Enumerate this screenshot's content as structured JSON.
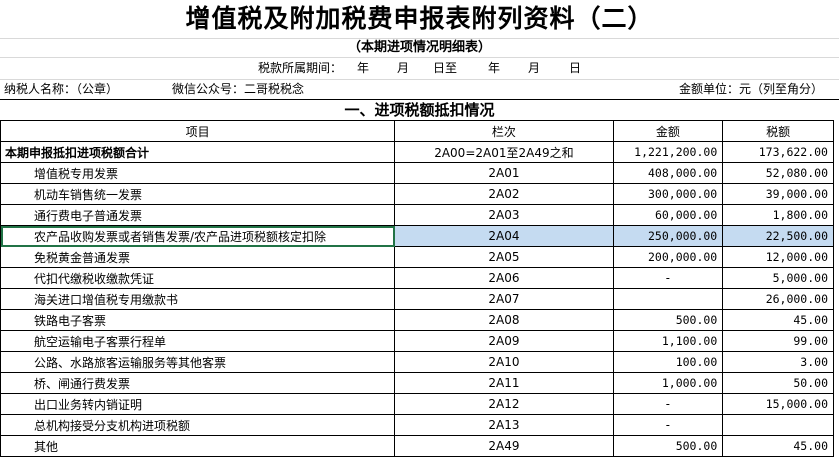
{
  "title": "增值税及附加税费申报表附列资料（二）",
  "subtitle": "（本期进项情况明细表）",
  "period": {
    "label": "税款所属期间：",
    "y1": "年",
    "m1": "月",
    "d1": "日至",
    "y2": "年",
    "m2": "月",
    "d2": "日"
  },
  "meta": {
    "taxpayer": "纳税人名称：（公章）",
    "wechat": "微信公众号：二哥税税念",
    "unit": "金额单位：元（列至角分）"
  },
  "section_title": "一、进项税额抵扣情况",
  "columns": [
    "项目",
    "栏次",
    "金额",
    "税额"
  ],
  "rows": [
    {
      "item": "本期申报抵扣进项税额合计",
      "col": "2A00=2A01至2A49之和",
      "amount": "1,221,200.00",
      "tax": "173,622.00"
    },
    {
      "item": "增值税专用发票",
      "col": "2A01",
      "amount": "408,000.00",
      "tax": "52,080.00"
    },
    {
      "item": "机动车销售统一发票",
      "col": "2A02",
      "amount": "300,000.00",
      "tax": "39,000.00"
    },
    {
      "item": "通行费电子普通发票",
      "col": "2A03",
      "amount": "60,000.00",
      "tax": "1,800.00"
    },
    {
      "item": "农产品收购发票或者销售发票/农产品进项税额核定扣除",
      "col": "2A04",
      "amount": "250,000.00",
      "tax": "22,500.00"
    },
    {
      "item": "免税黄金普通发票",
      "col": "2A05",
      "amount": "200,000.00",
      "tax": "12,000.00"
    },
    {
      "item": "代扣代缴税收缴款凭证",
      "col": "2A06",
      "amount": "-",
      "tax": "5,000.00"
    },
    {
      "item": "海关进口增值税专用缴款书",
      "col": "2A07",
      "amount": "",
      "tax": "26,000.00"
    },
    {
      "item": "铁路电子客票",
      "col": "2A08",
      "amount": "500.00",
      "tax": "45.00"
    },
    {
      "item": "航空运输电子客票行程单",
      "col": "2A09",
      "amount": "1,100.00",
      "tax": "99.00"
    },
    {
      "item": "公路、水路旅客运输服务等其他客票",
      "col": "2A10",
      "amount": "100.00",
      "tax": "3.00"
    },
    {
      "item": "桥、闸通行费发票",
      "col": "2A11",
      "amount": "1,000.00",
      "tax": "50.00"
    },
    {
      "item": "出口业务转内销证明",
      "col": "2A12",
      "amount": "-",
      "tax": "15,000.00"
    },
    {
      "item": "总机构接受分支机构进项税额",
      "col": "2A13",
      "amount": "-",
      "tax": ""
    },
    {
      "item": "其他",
      "col": "2A49",
      "amount": "500.00",
      "tax": "45.00"
    }
  ]
}
